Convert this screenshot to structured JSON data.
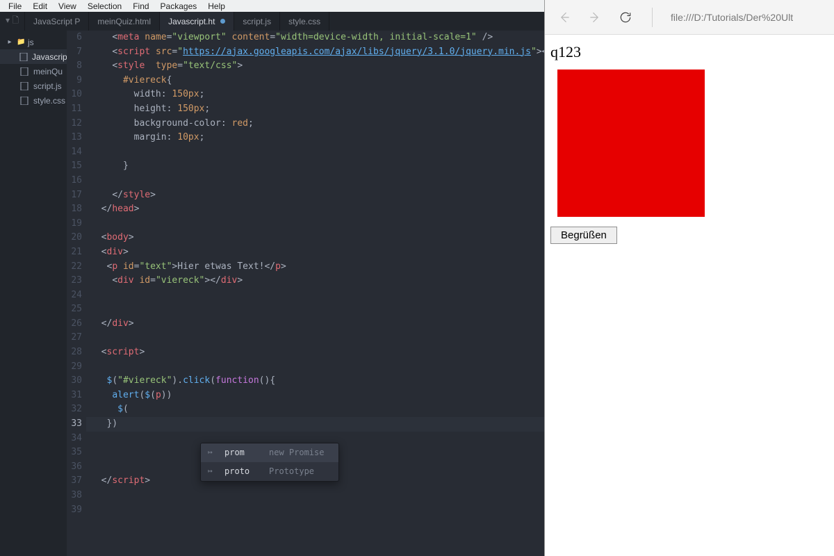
{
  "menu": {
    "items": [
      "File",
      "Edit",
      "View",
      "Selection",
      "Find",
      "Packages",
      "Help"
    ]
  },
  "tabs": [
    {
      "label": "JavaScript P",
      "active": false
    },
    {
      "label": "meinQuiz.html",
      "active": false
    },
    {
      "label": "Javascript.ht",
      "active": true,
      "modified": true
    },
    {
      "label": "script.js",
      "active": false
    },
    {
      "label": "style.css",
      "active": false
    }
  ],
  "tree": {
    "folder": "js",
    "files": [
      {
        "name": "Javascrip",
        "selected": true
      },
      {
        "name": "meinQu",
        "selected": false
      },
      {
        "name": "script.js",
        "selected": false
      },
      {
        "name": "style.css",
        "selected": false
      }
    ]
  },
  "lineStart": 6,
  "currentLine": 33,
  "autocomplete": {
    "items": [
      {
        "name": "prom",
        "hint": "new Promise",
        "selected": true
      },
      {
        "name": "proto",
        "hint": "Prototype",
        "selected": false
      }
    ]
  },
  "browser": {
    "url": "file:///D:/Tutorials/Der%20Ult",
    "pageText": "q123",
    "buttonLabel": "Begrüßen"
  }
}
